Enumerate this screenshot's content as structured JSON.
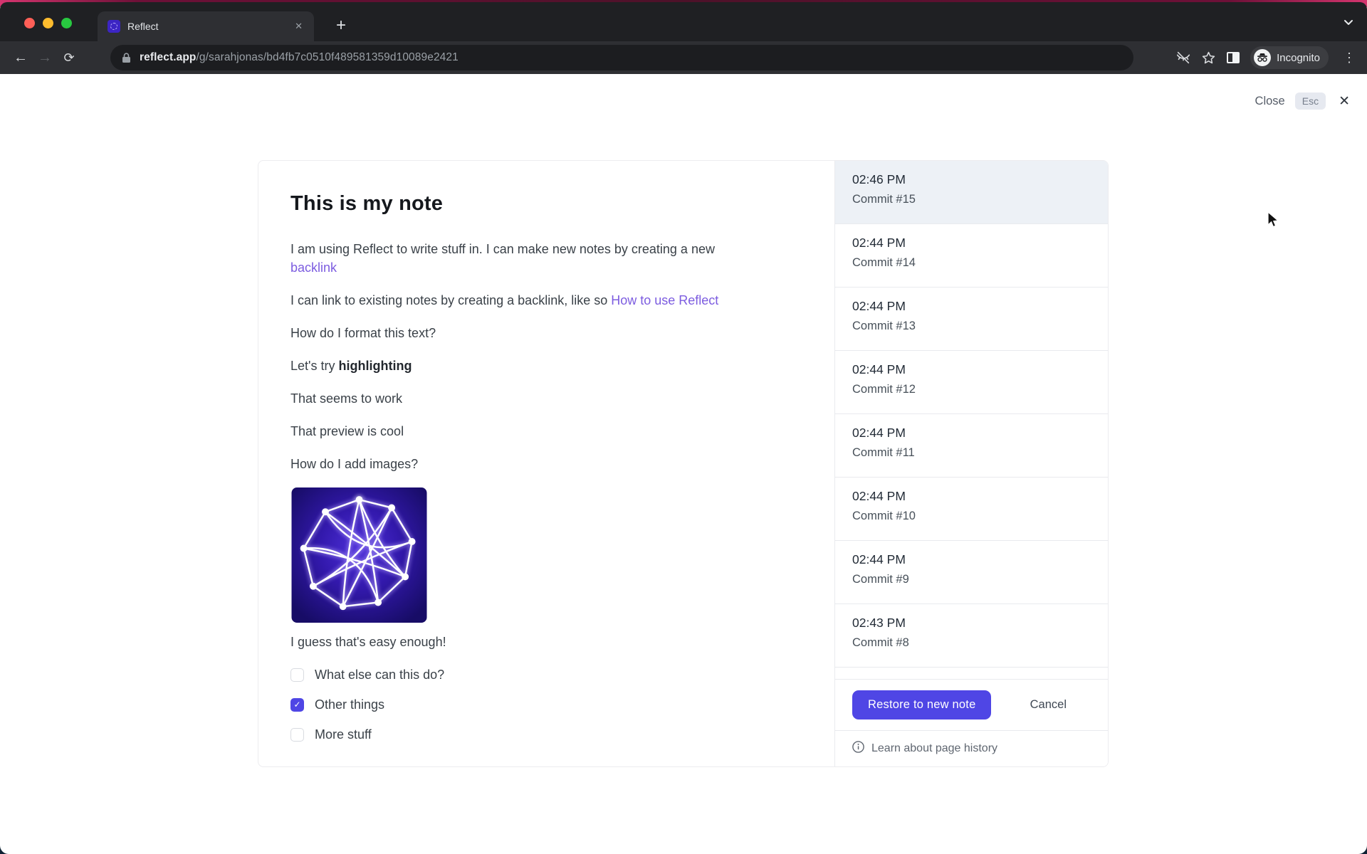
{
  "browser": {
    "tab_title": "Reflect",
    "tab_close": "✕",
    "new_tab": "+",
    "back": "←",
    "forward": "→",
    "reload": "⟳",
    "url_domain": "reflect.app",
    "url_path": "/g/sarahjonas/bd4fb7c0510f489581359d10089e2421",
    "incognito_label": "Incognito",
    "menu_dots": "⋮"
  },
  "overlay": {
    "close_label": "Close",
    "esc_key": "Esc",
    "close_x": "✕"
  },
  "note": {
    "title": "This is my note",
    "p1": "I am using Reflect to write stuff in. I can make new notes by creating a new",
    "p1_link": "backlink",
    "p2": "I can link to existing notes by creating a backlink, like so ",
    "p2_link": "How to use Reflect",
    "p3": "How do I format this text?",
    "p4": "Let's try ",
    "p4_bold": "highlighting",
    "p5": "That seems to work",
    "p6": "That preview is cool",
    "p7": "How do I add images?",
    "p8": "I guess that's easy enough!",
    "image_alt": "network-graph-image",
    "checklist": [
      {
        "label": "What else can this do?",
        "checked": false
      },
      {
        "label": "Other things",
        "checked": true
      },
      {
        "label": "More stuff",
        "checked": false
      }
    ],
    "check_glyph": "✓"
  },
  "history": {
    "commits": [
      {
        "time": "02:46 PM",
        "label": "Commit #15",
        "selected": true
      },
      {
        "time": "02:44 PM",
        "label": "Commit #14",
        "selected": false
      },
      {
        "time": "02:44 PM",
        "label": "Commit #13",
        "selected": false
      },
      {
        "time": "02:44 PM",
        "label": "Commit #12",
        "selected": false
      },
      {
        "time": "02:44 PM",
        "label": "Commit #11",
        "selected": false
      },
      {
        "time": "02:44 PM",
        "label": "Commit #10",
        "selected": false
      },
      {
        "time": "02:44 PM",
        "label": "Commit #9",
        "selected": false
      },
      {
        "time": "02:43 PM",
        "label": "Commit #8",
        "selected": false
      }
    ],
    "restore_button": "Restore to new note",
    "cancel_button": "Cancel",
    "footer_link": "Learn about page history"
  },
  "colors": {
    "accent": "#4f46e5",
    "note_link": "#7c5ce0",
    "highlight_link": "#5b6cd9",
    "selected_row": "#edf1f6",
    "chrome_dark": "#1f2023",
    "toolbar": "#2e2f33"
  }
}
